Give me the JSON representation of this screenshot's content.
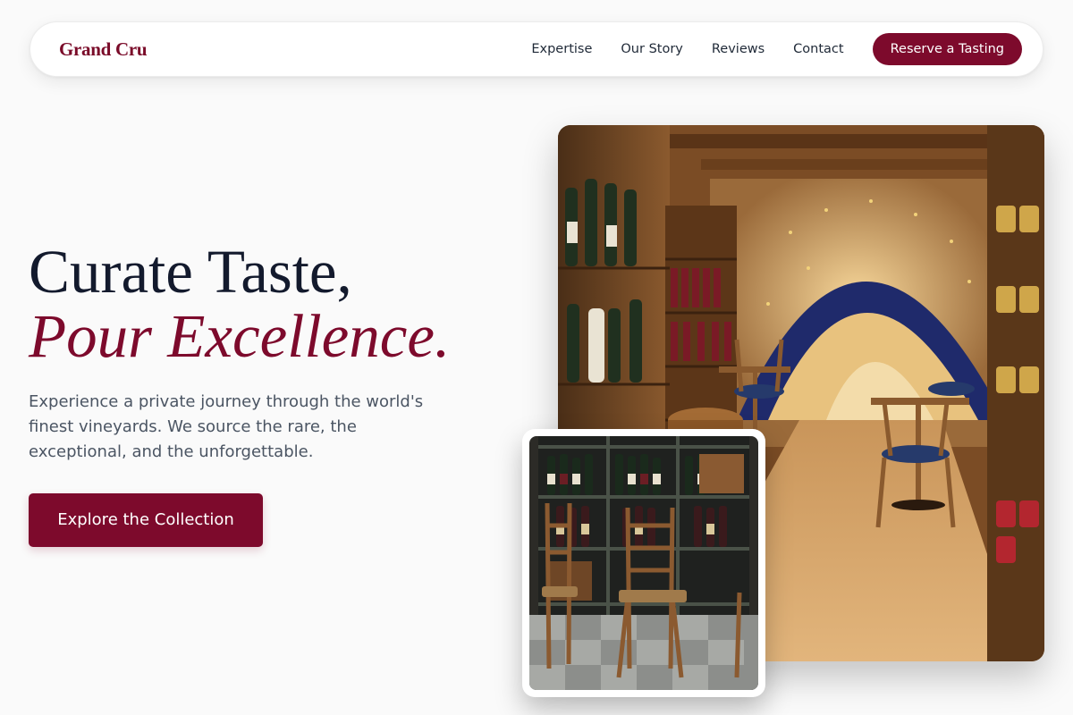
{
  "brand": {
    "name": "Grand Cru",
    "accent_color": "#7d0a2c"
  },
  "nav": {
    "links": [
      "Expertise",
      "Our Story",
      "Reviews",
      "Contact"
    ],
    "cta_label": "Reserve a Tasting"
  },
  "hero": {
    "title_line1": "Curate Taste,",
    "title_line2": "Pour Excellence.",
    "subtitle": "Experience a private journey through the world's finest vineyards. We source the rare, the exceptional, and the unforgettable.",
    "cta_label": "Explore the Collection"
  },
  "images": {
    "main": {
      "icon": "wine-cellar-photo"
    },
    "inset": {
      "icon": "wine-shelf-photo"
    }
  }
}
